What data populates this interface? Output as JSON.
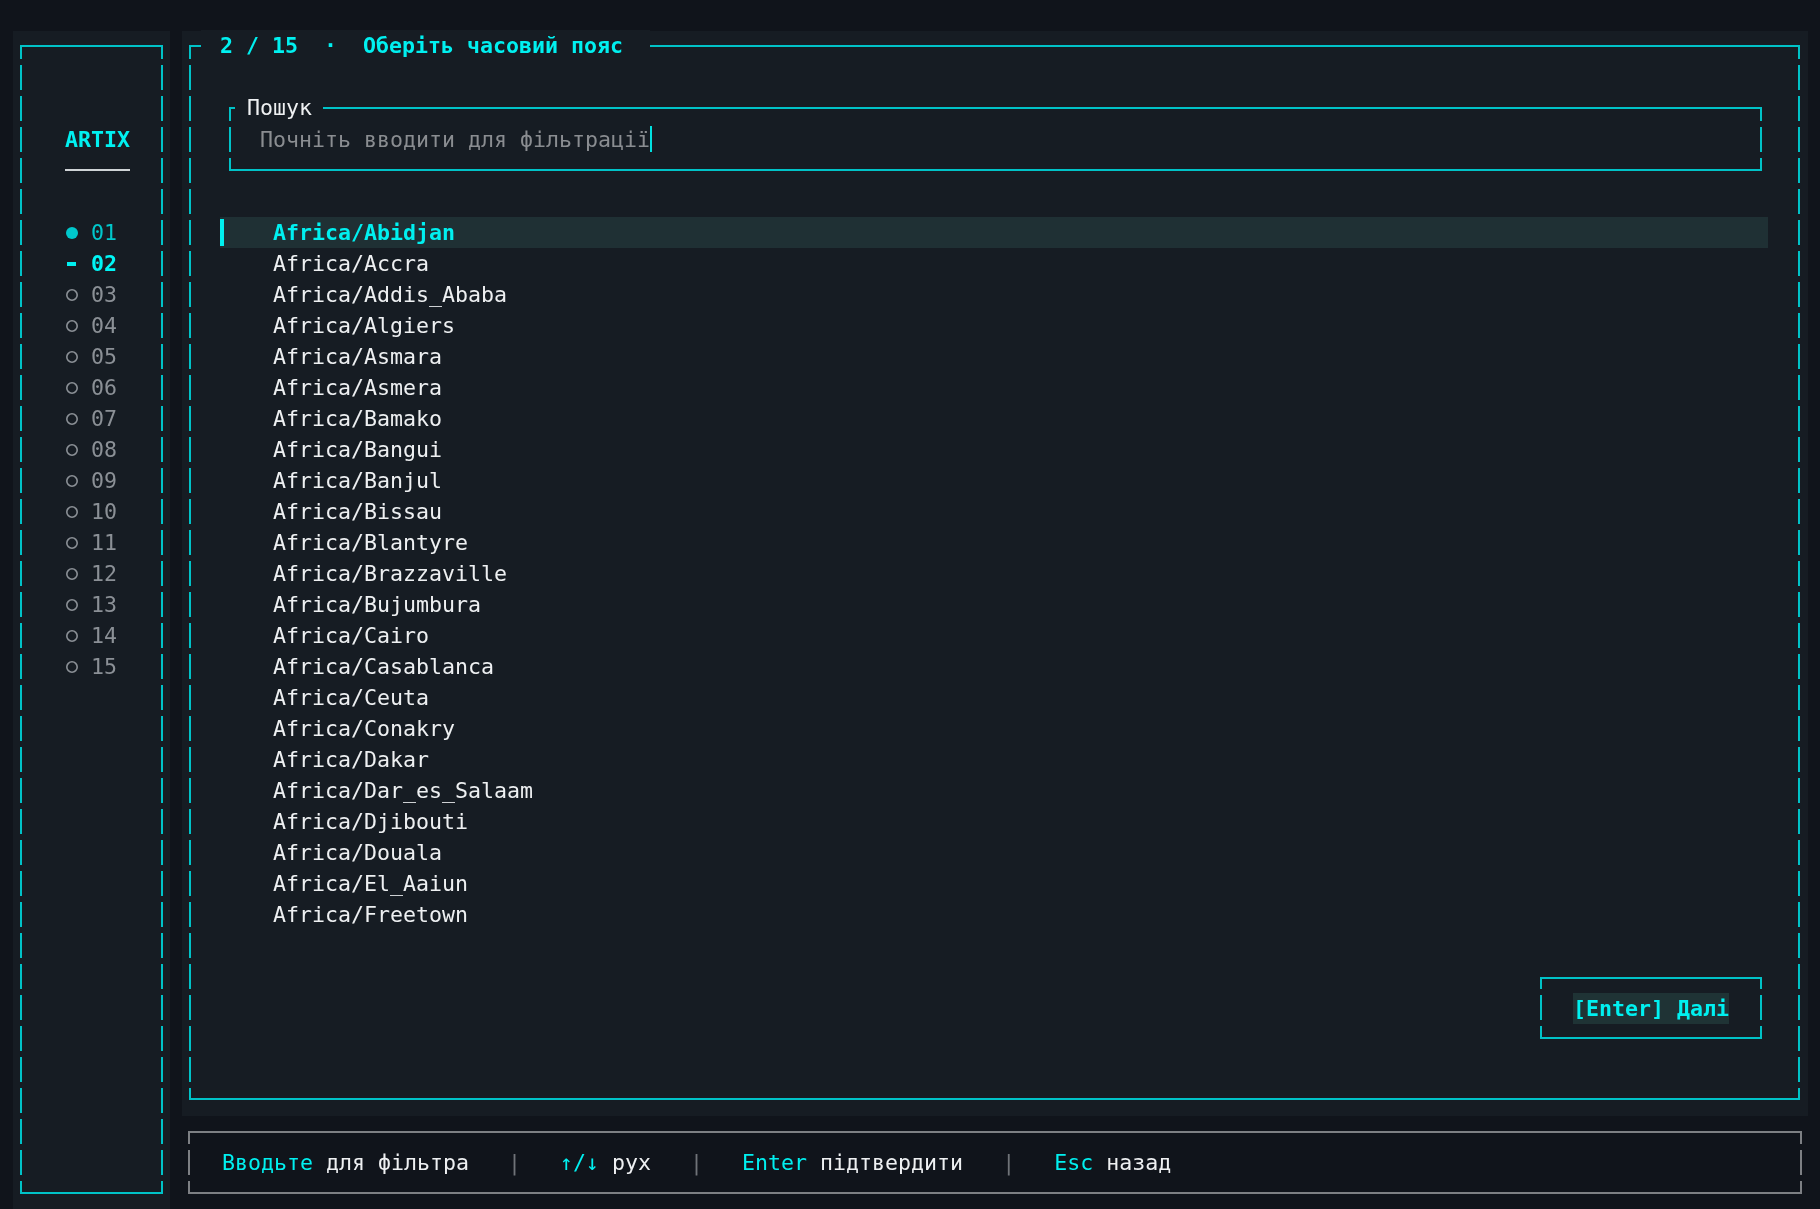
{
  "sidebar": {
    "logo": "ARTIX",
    "steps": [
      {
        "label": "01",
        "completed": true,
        "selected": false
      },
      {
        "label": "02",
        "completed": false,
        "selected": true
      },
      {
        "label": "03",
        "completed": false,
        "selected": false
      },
      {
        "label": "04",
        "completed": false,
        "selected": false
      },
      {
        "label": "05",
        "completed": false,
        "selected": false
      },
      {
        "label": "06",
        "completed": false,
        "selected": false
      },
      {
        "label": "07",
        "completed": false,
        "selected": false
      },
      {
        "label": "08",
        "completed": false,
        "selected": false
      },
      {
        "label": "09",
        "completed": false,
        "selected": false
      },
      {
        "label": "10",
        "completed": false,
        "selected": false
      },
      {
        "label": "11",
        "completed": false,
        "selected": false
      },
      {
        "label": "12",
        "completed": false,
        "selected": false
      },
      {
        "label": "13",
        "completed": false,
        "selected": false
      },
      {
        "label": "14",
        "completed": false,
        "selected": false
      },
      {
        "label": "15",
        "completed": false,
        "selected": false
      }
    ]
  },
  "panel": {
    "title": "2 / 15  ·  Оберіть часовий пояс",
    "search": {
      "label": "Пошук",
      "placeholder": "Почніть вводити для фільтрації",
      "focused": true
    },
    "timezones": [
      {
        "name": "Africa/Abidjan",
        "selected": true
      },
      {
        "name": "Africa/Accra",
        "selected": false
      },
      {
        "name": "Africa/Addis_Ababa",
        "selected": false
      },
      {
        "name": "Africa/Algiers",
        "selected": false
      },
      {
        "name": "Africa/Asmara",
        "selected": false
      },
      {
        "name": "Africa/Asmera",
        "selected": false
      },
      {
        "name": "Africa/Bamako",
        "selected": false
      },
      {
        "name": "Africa/Bangui",
        "selected": false
      },
      {
        "name": "Africa/Banjul",
        "selected": false
      },
      {
        "name": "Africa/Bissau",
        "selected": false
      },
      {
        "name": "Africa/Blantyre",
        "selected": false
      },
      {
        "name": "Africa/Brazzaville",
        "selected": false
      },
      {
        "name": "Africa/Bujumbura",
        "selected": false
      },
      {
        "name": "Africa/Cairo",
        "selected": false
      },
      {
        "name": "Africa/Casablanca",
        "selected": false
      },
      {
        "name": "Africa/Ceuta",
        "selected": false
      },
      {
        "name": "Africa/Conakry",
        "selected": false
      },
      {
        "name": "Africa/Dakar",
        "selected": false
      },
      {
        "name": "Africa/Dar_es_Salaam",
        "selected": false
      },
      {
        "name": "Africa/Djibouti",
        "selected": false
      },
      {
        "name": "Africa/Douala",
        "selected": false
      },
      {
        "name": "Africa/El_Aaiun",
        "selected": false
      },
      {
        "name": "Africa/Freetown",
        "selected": false
      }
    ],
    "next_button": {
      "label": "[Enter] Далі",
      "focused": true
    }
  },
  "footer": {
    "items": [
      {
        "kind": "hint",
        "key": "Вводьте",
        "action": "для фільтра"
      },
      {
        "kind": "separator",
        "text": "|"
      },
      {
        "kind": "hint",
        "key": "↑/↓",
        "action": "рух"
      },
      {
        "kind": "separator",
        "text": "|"
      },
      {
        "kind": "hint",
        "key": "Enter",
        "action": "підтвердити"
      },
      {
        "kind": "separator",
        "text": "|"
      },
      {
        "kind": "hint",
        "key": "Esc",
        "action": "назад"
      }
    ]
  }
}
